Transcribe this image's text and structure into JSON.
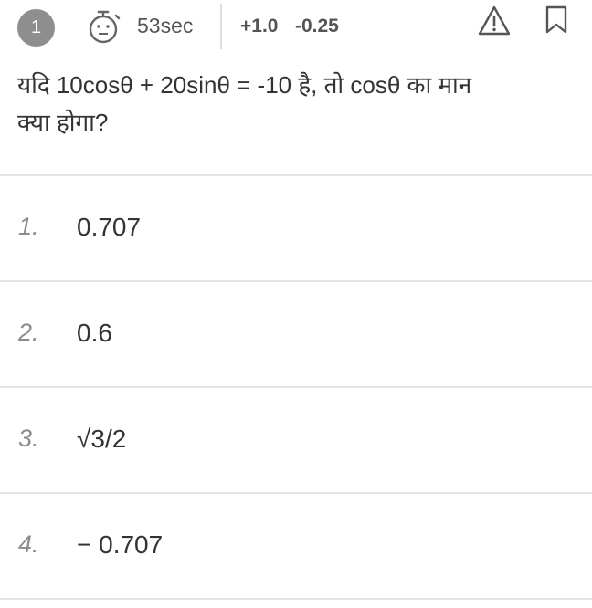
{
  "header": {
    "question_number": "1",
    "timer_text": "53sec",
    "positive_marks": "+1.0",
    "negative_marks": "-0.25",
    "timer_icon": "stopwatch-icon",
    "report_icon": "warning-triangle-icon",
    "bookmark_icon": "bookmark-icon"
  },
  "question": {
    "line1": "यदि 10cosθ + 20sinθ = -10 है, तो cosθ का मान",
    "line2": "क्या होगा?"
  },
  "options": [
    {
      "number": "1.",
      "text": "0.707"
    },
    {
      "number": "2.",
      "text": "0.6"
    },
    {
      "number": "3.",
      "text": "√3/2"
    },
    {
      "number": "4.",
      "text": "− 0.707"
    }
  ]
}
